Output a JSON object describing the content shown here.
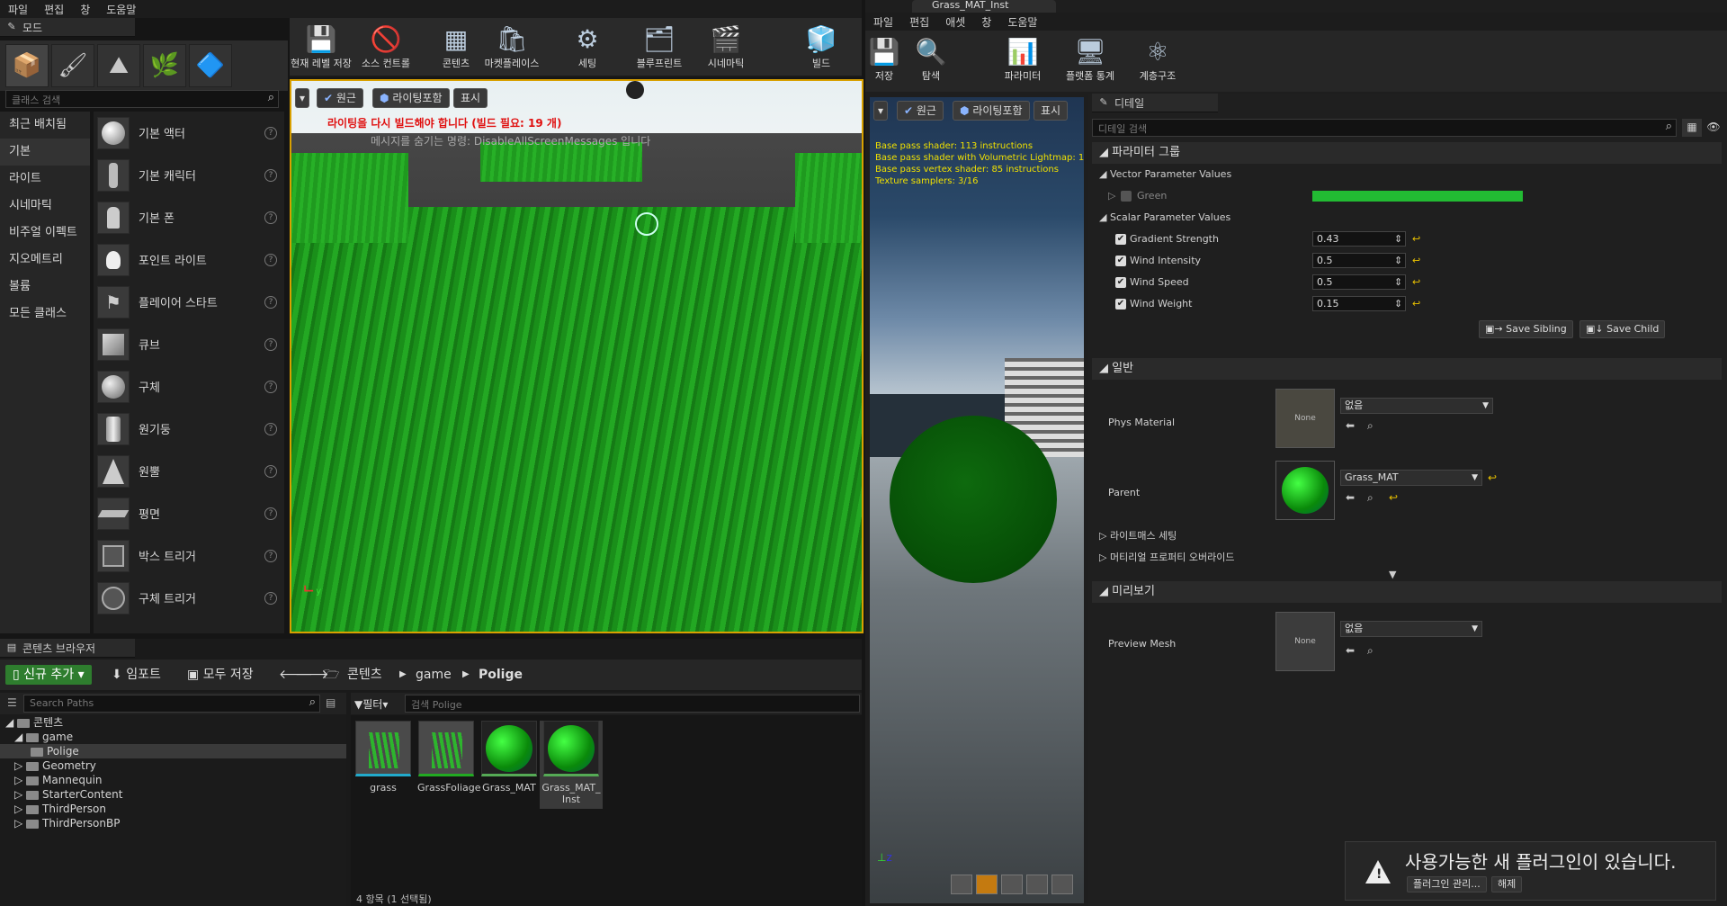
{
  "editor": {
    "menu": [
      "파일",
      "편집",
      "창",
      "도움말"
    ],
    "modes_tab": "모드",
    "class_search_placeholder": "클래스 검색",
    "categories": [
      "최근 배치됨",
      "기본",
      "라이트",
      "시네마틱",
      "비주얼 이펙트",
      "지오메트리",
      "볼륨",
      "모든 클래스"
    ],
    "place_items": [
      "기본 액터",
      "기본 캐릭터",
      "기본 폰",
      "포인트 라이트",
      "플레이어 스타트",
      "큐브",
      "구체",
      "원기둥",
      "원뿔",
      "평면",
      "박스 트리거",
      "구체 트리거"
    ],
    "toolbar": [
      "현재 레벨 저장",
      "소스 컨트롤",
      "콘텐츠",
      "마켓플레이스",
      "세팅",
      "블루프린트",
      "시네마틱",
      "빌드"
    ],
    "viewport": {
      "menu_arrow": "▾",
      "perspective": "원근",
      "lit": "라이팅포함",
      "show": "표시",
      "warning": "라이팅을 다시 빌드해야 합니다 (빌드 필요: 19 개)",
      "hint": "메시지를 숨기는 명령: DisableAllScreenMessages 입니다"
    }
  },
  "content_browser": {
    "tab": "콘텐츠 브라우저",
    "add_new": "신규 추가",
    "import": "임포트",
    "save_all": "모두 저장",
    "crumbs": [
      "콘텐츠",
      "game",
      "Polige"
    ],
    "search_paths_placeholder": "Search Paths",
    "filter": "필터",
    "search_placeholder": "검색 Polige",
    "tree": {
      "root": "콘텐츠",
      "game": "game",
      "polige": "Polige",
      "others": [
        "Geometry",
        "Mannequin",
        "StarterContent",
        "ThirdPerson",
        "ThirdPersonBP"
      ]
    },
    "assets": [
      "grass",
      "GrassFoliage",
      "Grass_MAT",
      "Grass_MAT_\nInst"
    ],
    "status": "4 항목 (1 선택됨)"
  },
  "material_editor": {
    "tab": "Grass_MAT_Inst",
    "menu": [
      "파일",
      "편집",
      "애셋",
      "창",
      "도움말"
    ],
    "toolbar": [
      "저장",
      "탐색",
      "파라미터",
      "플랫폼 통계",
      "계층구조"
    ],
    "preview": {
      "menu_arrow": "▾",
      "perspective": "원근",
      "lit": "라이팅포함",
      "show": "표시",
      "stats": [
        "Base pass shader: 113 instructions",
        "Base pass shader with Volumetric Lightmap: 1",
        "Base pass vertex shader: 85 instructions",
        "Texture samplers: 3/16"
      ]
    },
    "details": {
      "tab": "디테일",
      "search_placeholder": "디테일 검색",
      "param_group": "파라미터 그룹",
      "vector_header": "Vector Parameter Values",
      "vector_param": "Green",
      "vector_color": "#22bb33",
      "scalar_header": "Scalar Parameter Values",
      "scalars": [
        {
          "name": "Gradient Strength",
          "value": "0.43"
        },
        {
          "name": "Wind Intensity",
          "value": "0.5"
        },
        {
          "name": "Wind Speed",
          "value": "0.5"
        },
        {
          "name": "Wind Weight",
          "value": "0.15"
        }
      ],
      "save_sibling": "Save Sibling",
      "save_child": "Save Child",
      "general": "일반",
      "phys_material": "Phys Material",
      "none": "None",
      "none_kr": "없음",
      "parent": "Parent",
      "parent_value": "Grass_MAT",
      "lightmass": "라이트매스 세팅",
      "overrides": "머티리얼 프로퍼티 오버라이드",
      "preview_section": "미리보기",
      "preview_mesh": "Preview Mesh"
    }
  },
  "notification": {
    "text": "사용가능한 새 플러그인이 있습니다.",
    "manage": "플러그인 관리...",
    "dismiss": "해제"
  },
  "colors": {
    "accent": "#d8a000",
    "grass": "#1f9a1f",
    "warning": "#ff3030"
  }
}
